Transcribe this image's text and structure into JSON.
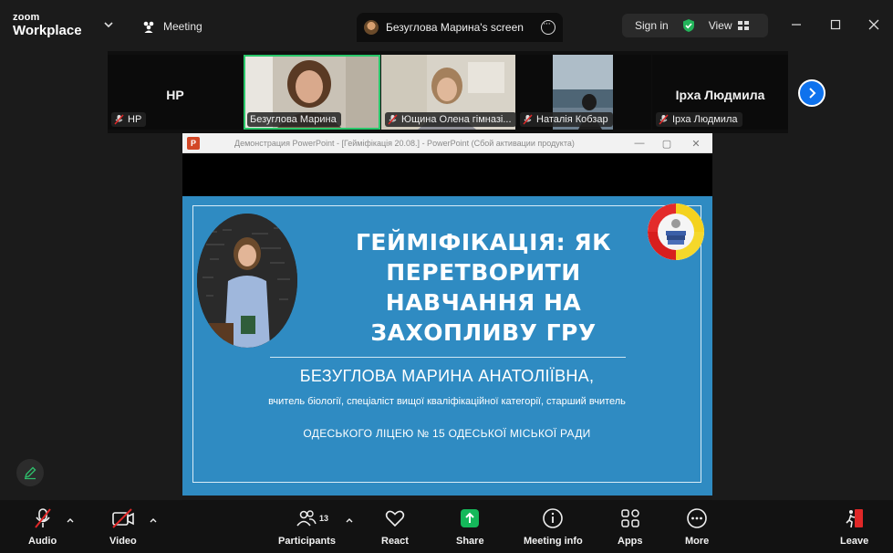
{
  "app": {
    "logo_line1": "zoom",
    "logo_line2": "Workplace"
  },
  "titlebar": {
    "meeting_label": "Meeting",
    "share_tab_label": "Безуглова Марина's screen",
    "sign_in": "Sign in",
    "view": "View"
  },
  "participants": [
    {
      "name": "НР",
      "big_label": "НР",
      "muted": true,
      "video": false
    },
    {
      "name": "Безуглова Марина",
      "muted": false,
      "video": true,
      "active": true
    },
    {
      "name": "Ющина Олена гімназі...",
      "muted": true,
      "video": true
    },
    {
      "name": "Наталія Кобзар",
      "muted": true,
      "video": true
    },
    {
      "name": "Ірха Людмила",
      "big_label": "Ірха Людмила",
      "muted": true,
      "video": false
    }
  ],
  "shared_window": {
    "title": "Демонстрация PowerPoint - [Гейміфікація 20.08.] - PowerPoint (Сбой активации продукта)",
    "ppt_letter": "P"
  },
  "slide": {
    "title": "ГЕЙМІФІКАЦІЯ: ЯК ПЕРЕТВОРИТИ НАВЧАННЯ НА ЗАХОПЛИВУ ГРУ",
    "author": "БЕЗУГЛОВА МАРИНА АНАТОЛІЇВНА,",
    "role": "вчитель біології, спеціаліст вищої кваліфікаційної категорії, старший вчитель",
    "school": "ОДЕСЬКОГО ЛІЦЕЮ № 15 ОДЕСЬКОЇ МІСЬКОЇ РАДИ",
    "background_color": "#2f8bc2"
  },
  "toolbar": {
    "audio": "Audio",
    "video": "Video",
    "participants": "Participants",
    "participants_count": "13",
    "react": "React",
    "share": "Share",
    "meeting_info": "Meeting info",
    "apps": "Apps",
    "more": "More",
    "leave": "Leave"
  },
  "colors": {
    "accent_blue": "#0e72ed",
    "share_green": "#14b85a",
    "leave_red": "#e02828",
    "active_border": "#29c76a"
  },
  "icons": [
    "people-icon",
    "shield-check-icon",
    "grid-icon",
    "mic-off-icon",
    "video-off-icon",
    "participants-icon",
    "heart-icon",
    "share-arrow-icon",
    "info-icon",
    "apps-icon",
    "more-dots-icon",
    "leave-icon",
    "pencil-icon",
    "chevron-right-icon"
  ]
}
